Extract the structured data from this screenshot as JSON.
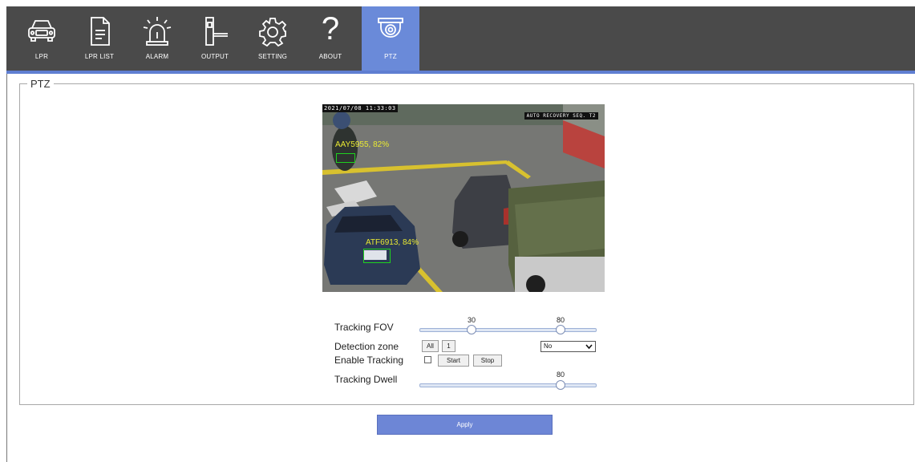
{
  "nav": {
    "items": [
      {
        "label": "LPR",
        "icon": "car-icon"
      },
      {
        "label": "LPR LIST",
        "icon": "document-icon"
      },
      {
        "label": "ALARM",
        "icon": "alarm-light-icon"
      },
      {
        "label": "OUTPUT",
        "icon": "barrier-gate-icon"
      },
      {
        "label": "SETTING",
        "icon": "gear-icon"
      },
      {
        "label": "ABOUT",
        "icon": "question-mark-icon",
        "glyph": "?"
      },
      {
        "label": "PTZ",
        "icon": "dome-camera-icon",
        "active": true
      }
    ]
  },
  "colors": {
    "nav_bg": "#4a4a4a",
    "nav_active": "#6a8ad9",
    "accent": "#5f7ed1",
    "apply_bg": "#6d86d6",
    "plate_text": "#e9e932",
    "plate_box": "#1fd11f"
  },
  "ptz": {
    "legend": "PTZ",
    "camera": {
      "osd_time": "2021/07/08 11:33:03",
      "osd_mode": "AUTO RECOVERY SEQ. T2",
      "detections": [
        {
          "text": "AAY5955, 82%"
        },
        {
          "text": "ATF6913, 84%"
        }
      ]
    },
    "tracking_fov": {
      "label": "Tracking FOV",
      "min_value": "30",
      "max_value": "80"
    },
    "detection_zone": {
      "label": "Detection zone",
      "buttons": [
        "All",
        "1"
      ],
      "select_value": "No"
    },
    "enable_tracking": {
      "label": "Enable Tracking",
      "checked": false,
      "start_label": "Start",
      "stop_label": "Stop"
    },
    "tracking_dwell": {
      "label": "Tracking Dwell",
      "value": "80"
    },
    "apply_label": "Apply"
  }
}
